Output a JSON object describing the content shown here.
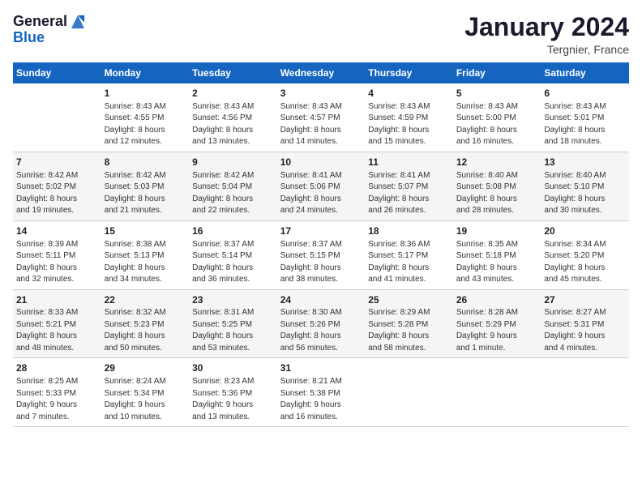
{
  "header": {
    "logo_line1": "General",
    "logo_line2": "Blue",
    "month": "January 2024",
    "location": "Tergnier, France"
  },
  "columns": [
    "Sunday",
    "Monday",
    "Tuesday",
    "Wednesday",
    "Thursday",
    "Friday",
    "Saturday"
  ],
  "weeks": [
    [
      {
        "num": "",
        "info": ""
      },
      {
        "num": "1",
        "info": "Sunrise: 8:43 AM\nSunset: 4:55 PM\nDaylight: 8 hours\nand 12 minutes."
      },
      {
        "num": "2",
        "info": "Sunrise: 8:43 AM\nSunset: 4:56 PM\nDaylight: 8 hours\nand 13 minutes."
      },
      {
        "num": "3",
        "info": "Sunrise: 8:43 AM\nSunset: 4:57 PM\nDaylight: 8 hours\nand 14 minutes."
      },
      {
        "num": "4",
        "info": "Sunrise: 8:43 AM\nSunset: 4:59 PM\nDaylight: 8 hours\nand 15 minutes."
      },
      {
        "num": "5",
        "info": "Sunrise: 8:43 AM\nSunset: 5:00 PM\nDaylight: 8 hours\nand 16 minutes."
      },
      {
        "num": "6",
        "info": "Sunrise: 8:43 AM\nSunset: 5:01 PM\nDaylight: 8 hours\nand 18 minutes."
      }
    ],
    [
      {
        "num": "7",
        "info": "Sunrise: 8:42 AM\nSunset: 5:02 PM\nDaylight: 8 hours\nand 19 minutes."
      },
      {
        "num": "8",
        "info": "Sunrise: 8:42 AM\nSunset: 5:03 PM\nDaylight: 8 hours\nand 21 minutes."
      },
      {
        "num": "9",
        "info": "Sunrise: 8:42 AM\nSunset: 5:04 PM\nDaylight: 8 hours\nand 22 minutes."
      },
      {
        "num": "10",
        "info": "Sunrise: 8:41 AM\nSunset: 5:06 PM\nDaylight: 8 hours\nand 24 minutes."
      },
      {
        "num": "11",
        "info": "Sunrise: 8:41 AM\nSunset: 5:07 PM\nDaylight: 8 hours\nand 26 minutes."
      },
      {
        "num": "12",
        "info": "Sunrise: 8:40 AM\nSunset: 5:08 PM\nDaylight: 8 hours\nand 28 minutes."
      },
      {
        "num": "13",
        "info": "Sunrise: 8:40 AM\nSunset: 5:10 PM\nDaylight: 8 hours\nand 30 minutes."
      }
    ],
    [
      {
        "num": "14",
        "info": "Sunrise: 8:39 AM\nSunset: 5:11 PM\nDaylight: 8 hours\nand 32 minutes."
      },
      {
        "num": "15",
        "info": "Sunrise: 8:38 AM\nSunset: 5:13 PM\nDaylight: 8 hours\nand 34 minutes."
      },
      {
        "num": "16",
        "info": "Sunrise: 8:37 AM\nSunset: 5:14 PM\nDaylight: 8 hours\nand 36 minutes."
      },
      {
        "num": "17",
        "info": "Sunrise: 8:37 AM\nSunset: 5:15 PM\nDaylight: 8 hours\nand 38 minutes."
      },
      {
        "num": "18",
        "info": "Sunrise: 8:36 AM\nSunset: 5:17 PM\nDaylight: 8 hours\nand 41 minutes."
      },
      {
        "num": "19",
        "info": "Sunrise: 8:35 AM\nSunset: 5:18 PM\nDaylight: 8 hours\nand 43 minutes."
      },
      {
        "num": "20",
        "info": "Sunrise: 8:34 AM\nSunset: 5:20 PM\nDaylight: 8 hours\nand 45 minutes."
      }
    ],
    [
      {
        "num": "21",
        "info": "Sunrise: 8:33 AM\nSunset: 5:21 PM\nDaylight: 8 hours\nand 48 minutes."
      },
      {
        "num": "22",
        "info": "Sunrise: 8:32 AM\nSunset: 5:23 PM\nDaylight: 8 hours\nand 50 minutes."
      },
      {
        "num": "23",
        "info": "Sunrise: 8:31 AM\nSunset: 5:25 PM\nDaylight: 8 hours\nand 53 minutes."
      },
      {
        "num": "24",
        "info": "Sunrise: 8:30 AM\nSunset: 5:26 PM\nDaylight: 8 hours\nand 56 minutes."
      },
      {
        "num": "25",
        "info": "Sunrise: 8:29 AM\nSunset: 5:28 PM\nDaylight: 8 hours\nand 58 minutes."
      },
      {
        "num": "26",
        "info": "Sunrise: 8:28 AM\nSunset: 5:29 PM\nDaylight: 9 hours\nand 1 minute."
      },
      {
        "num": "27",
        "info": "Sunrise: 8:27 AM\nSunset: 5:31 PM\nDaylight: 9 hours\nand 4 minutes."
      }
    ],
    [
      {
        "num": "28",
        "info": "Sunrise: 8:25 AM\nSunset: 5:33 PM\nDaylight: 9 hours\nand 7 minutes."
      },
      {
        "num": "29",
        "info": "Sunrise: 8:24 AM\nSunset: 5:34 PM\nDaylight: 9 hours\nand 10 minutes."
      },
      {
        "num": "30",
        "info": "Sunrise: 8:23 AM\nSunset: 5:36 PM\nDaylight: 9 hours\nand 13 minutes."
      },
      {
        "num": "31",
        "info": "Sunrise: 8:21 AM\nSunset: 5:38 PM\nDaylight: 9 hours\nand 16 minutes."
      },
      {
        "num": "",
        "info": ""
      },
      {
        "num": "",
        "info": ""
      },
      {
        "num": "",
        "info": ""
      }
    ]
  ]
}
